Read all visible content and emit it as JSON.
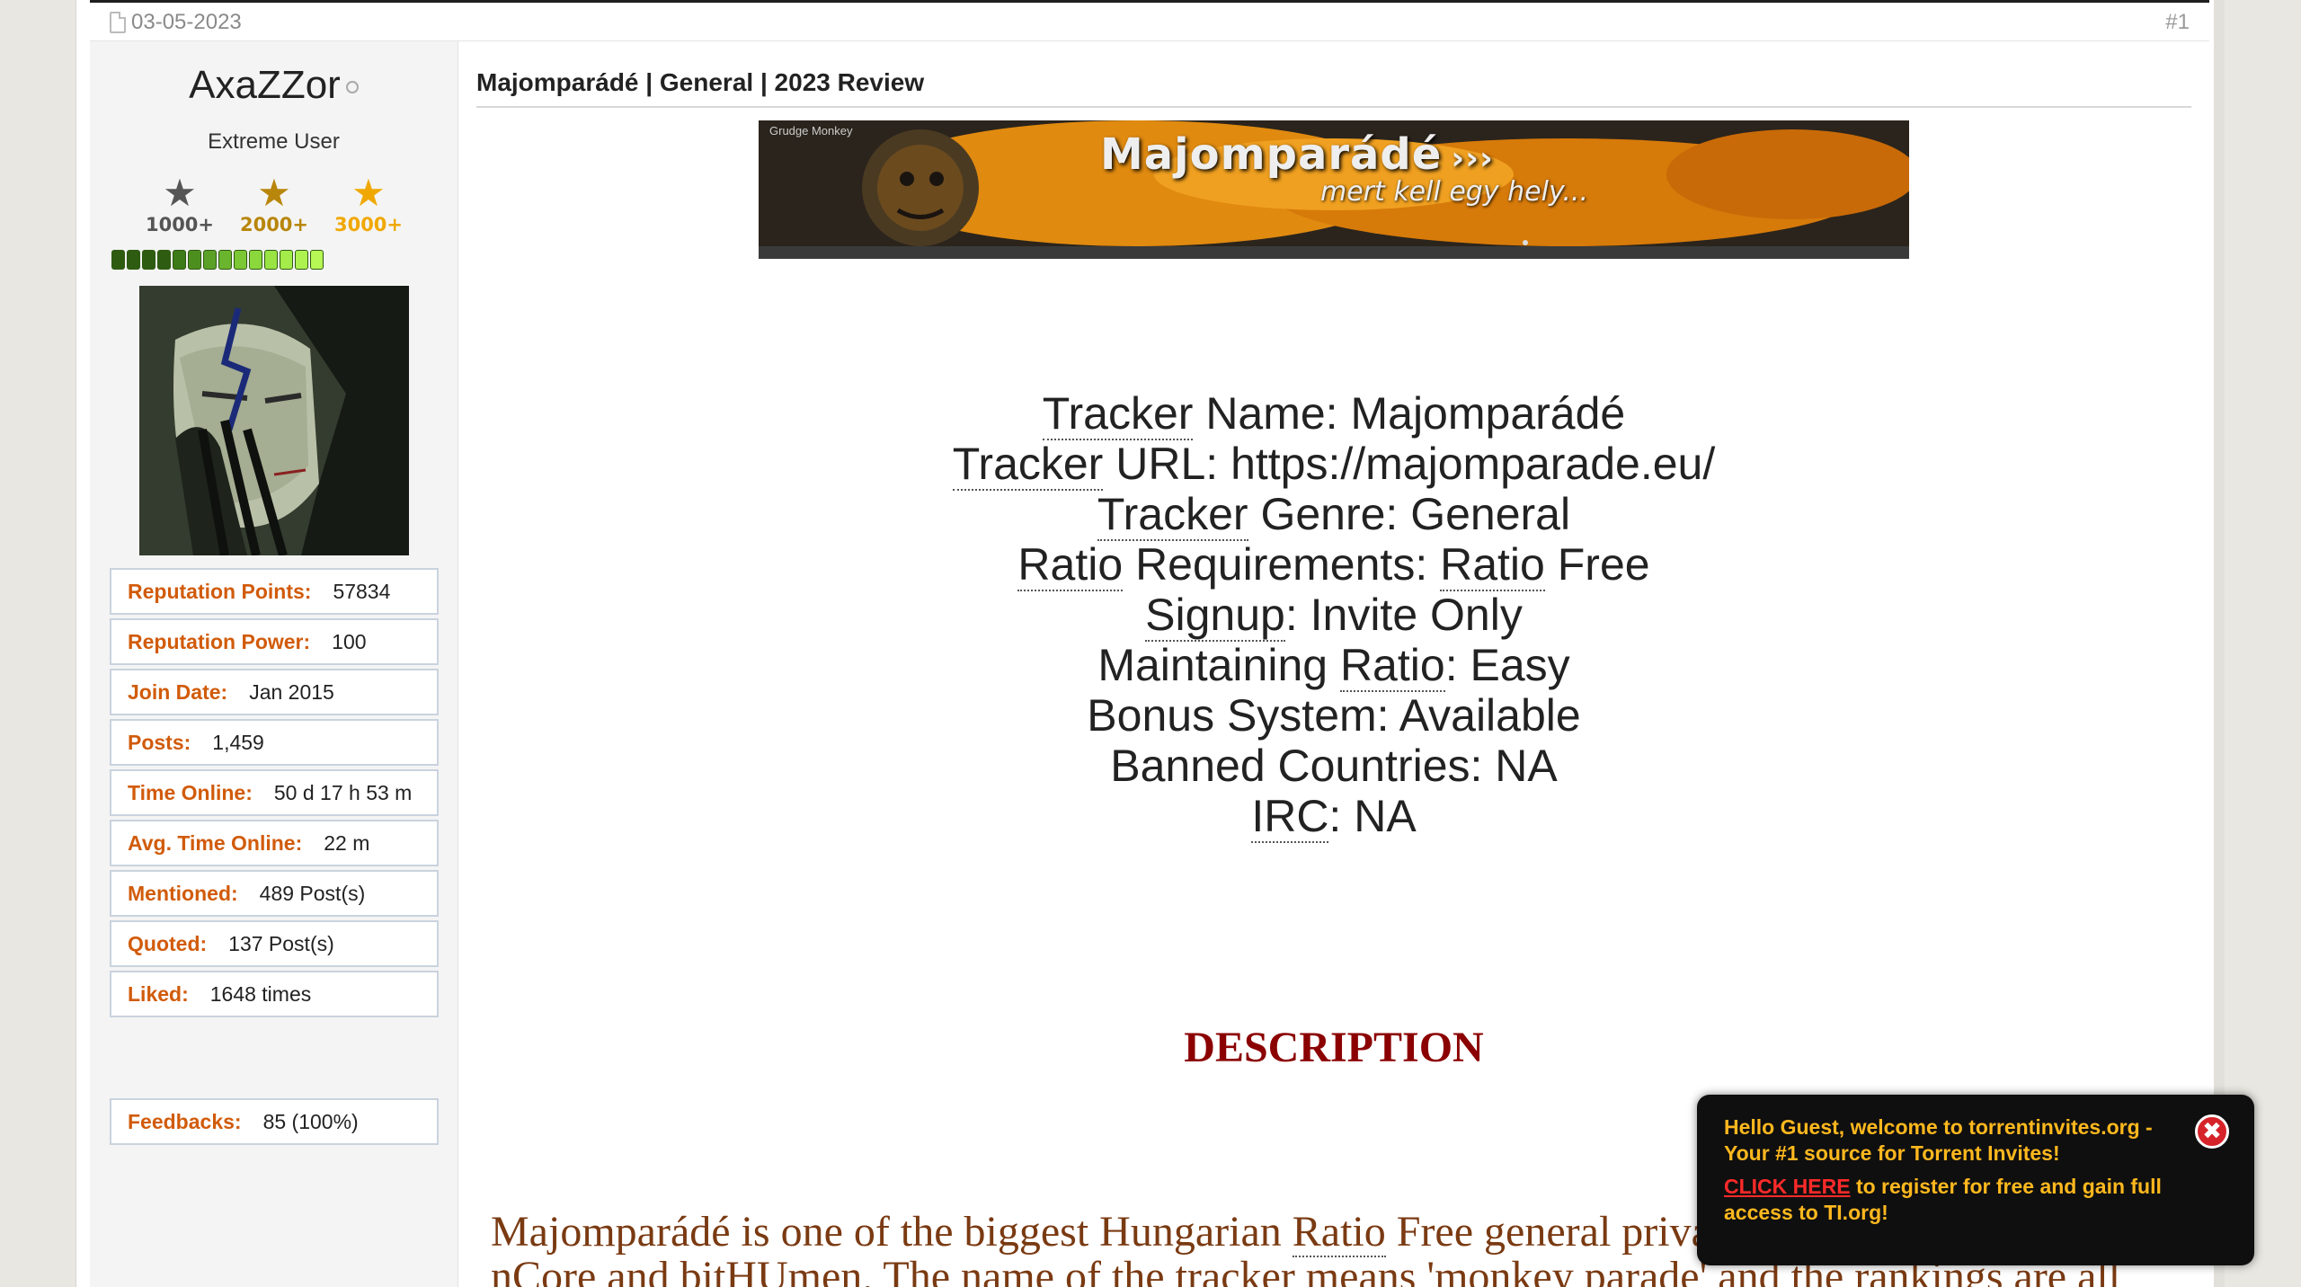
{
  "post": {
    "date": "03-05-2023",
    "number": "#1",
    "title": "Majomparádé | General | 2023 Review"
  },
  "user": {
    "name": "AxaZZor",
    "title": "Extreme User",
    "badges": [
      {
        "label": "1000+",
        "color": "#555555"
      },
      {
        "label": "2000+",
        "color": "#b8860b"
      },
      {
        "label": "3000+",
        "color": "#f0a800"
      }
    ],
    "reputation_segments": 14,
    "stats": [
      {
        "label": "Reputation Points:",
        "value": "57834"
      },
      {
        "label": "Reputation Power:",
        "value": "100"
      },
      {
        "label": "Join Date:",
        "value": "Jan 2015"
      },
      {
        "label": "Posts:",
        "value": "1,459"
      },
      {
        "label": "Time Online:",
        "value": "50 d 17 h 53 m"
      },
      {
        "label": "Avg. Time Online:",
        "value": "22 m"
      },
      {
        "label": "Mentioned:",
        "value": "489 Post(s)"
      },
      {
        "label": "Quoted:",
        "value": "137 Post(s)"
      },
      {
        "label": "Liked:",
        "value": "1648 times"
      }
    ],
    "feedback": {
      "label": "Feedbacks:",
      "value": "85 (100%)"
    }
  },
  "banner": {
    "title": "Majomparádé",
    "arrows": "›››",
    "subtitle": "mert kell egy hely...",
    "tag": "Grudge Monkey"
  },
  "tracker_info": {
    "name_label": "Name: ",
    "name": "Majomparádé",
    "url_label": "URL: ",
    "url": "https://majomparade.eu/",
    "genre_label": "Genre: ",
    "genre": "General",
    "ratio_req_label": "Requirements: ",
    "ratio_req": "Free",
    "signup_label": "Signup",
    "signup": ": Invite Only",
    "maintaining_label": "Maintaining ",
    "maintaining": ": Easy",
    "bonus": "Bonus System: Available",
    "banned": "Banned Countries: NA",
    "irc_label": "IRC",
    "irc": ": NA",
    "term_tracker": "Tracker",
    "term_ratio": "Ratio"
  },
  "description": {
    "heading": "DESCRIPTION",
    "line1_start": "Majomparádé is one of the biggest Hungarian ",
    "line1_term": "Ratio",
    "line1_end": " Free general private trackers that comes after",
    "line2": "nCore and bitHUmen. The name of the tracker means 'monkey parade' and the rankings are all"
  },
  "popup": {
    "greeting": "Hello Guest, welcome to torrentinvites.org - Your #1 source for Torrent Invites!",
    "link_text": "CLICK HERE",
    "link_rest": " to register for free and gain full access to TI.org!",
    "close_label": "✖"
  }
}
